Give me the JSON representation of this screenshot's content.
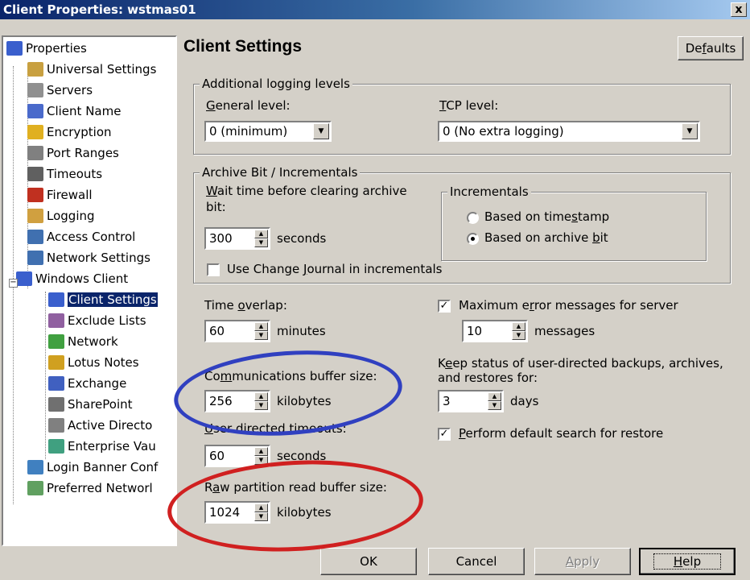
{
  "window": {
    "title": "Client Properties: wstmas01",
    "close": "x"
  },
  "tree": {
    "items": [
      {
        "label": "Properties",
        "color": "#3a5fcd"
      },
      {
        "label": "Universal Settings",
        "color": "#c8a040"
      },
      {
        "label": "Servers",
        "color": "#909090"
      },
      {
        "label": "Client Name",
        "color": "#4a6acb"
      },
      {
        "label": "Encryption",
        "color": "#e0b020"
      },
      {
        "label": "Port Ranges",
        "color": "#808080"
      },
      {
        "label": "Timeouts",
        "color": "#606060"
      },
      {
        "label": "Firewall",
        "color": "#c03020"
      },
      {
        "label": "Logging",
        "color": "#d0a040"
      },
      {
        "label": "Access Control",
        "color": "#4070b0"
      },
      {
        "label": "Network Settings",
        "color": "#4070b0"
      },
      {
        "label": "Windows Client",
        "color": "#3a5fcd"
      },
      {
        "label": "Client Settings",
        "color": "#3a5fcd"
      },
      {
        "label": "Exclude Lists",
        "color": "#9060a0"
      },
      {
        "label": "Network",
        "color": "#40a040"
      },
      {
        "label": "Lotus Notes",
        "color": "#d0a020"
      },
      {
        "label": "Exchange",
        "color": "#4060c0"
      },
      {
        "label": "SharePoint",
        "color": "#707070"
      },
      {
        "label": "Active Directo",
        "color": "#808080"
      },
      {
        "label": "Enterprise Vau",
        "color": "#40a080"
      },
      {
        "label": "Login Banner Conf",
        "color": "#4080c0"
      },
      {
        "label": "Preferred Networl",
        "color": "#60a060"
      }
    ]
  },
  "panel": {
    "heading": "Client Settings",
    "defaults_button": {
      "pre": "De",
      "u": "f",
      "post": "aults"
    },
    "logging": {
      "group_label": "Additional logging levels",
      "general_label": {
        "u": "G",
        "post": "eneral level:"
      },
      "general_value": "0  (minimum)",
      "tcp_label": {
        "u": "T",
        "post": "CP level:"
      },
      "tcp_value": "0 (No extra logging)"
    },
    "archive": {
      "group_label": "Archive Bit / Incrementals",
      "wait_label_1": {
        "u": "W",
        "post": "ait time before clearing archive"
      },
      "wait_label_2": "bit:",
      "wait_value": "300",
      "wait_unit": "seconds",
      "journal_label": {
        "pre": "Use Change ",
        "u": "J",
        "post": "ournal in incrementals"
      },
      "incrementals_label": "Incrementals",
      "radio_timestamp": {
        "pre": "Based on time",
        "u": "s",
        "post": "tamp"
      },
      "radio_archive": {
        "pre": "Based on archive ",
        "u": "b",
        "post": "it"
      }
    },
    "time_overlap": {
      "pre": "Time ",
      "u": "o",
      "post": "verlap:",
      "value": "60",
      "unit": "minutes"
    },
    "comm_buffer": {
      "pre": "Co",
      "u": "m",
      "post": "munications buffer size:",
      "value": "256",
      "unit": "kilobytes"
    },
    "user_timeouts": {
      "u": "U",
      "post": "ser directed timeouts:",
      "value": "60",
      "unit": "seconds"
    },
    "raw_buffer": {
      "pre": "R",
      "u": "a",
      "post": "w partition read buffer size:",
      "value": "1024",
      "unit": "kilobytes"
    },
    "max_errors": {
      "pre": "Maximum e",
      "u": "r",
      "post": "ror messages for server",
      "value": "10",
      "unit": "messages"
    },
    "keep_status": {
      "line1": {
        "pre": "K",
        "u": "e",
        "post": "ep status of user-directed backups, archives,"
      },
      "line2": "and restores for:",
      "value": "3",
      "unit": "days"
    },
    "default_search": {
      "u": "P",
      "post": "erform default search for restore"
    }
  },
  "buttons": {
    "ok": "OK",
    "cancel": "Cancel",
    "apply": {
      "u": "A",
      "post": "pply"
    },
    "help": {
      "u": "H",
      "post": "elp"
    }
  },
  "annotations": {
    "blue": "#3040c0",
    "red": "#d02020"
  }
}
